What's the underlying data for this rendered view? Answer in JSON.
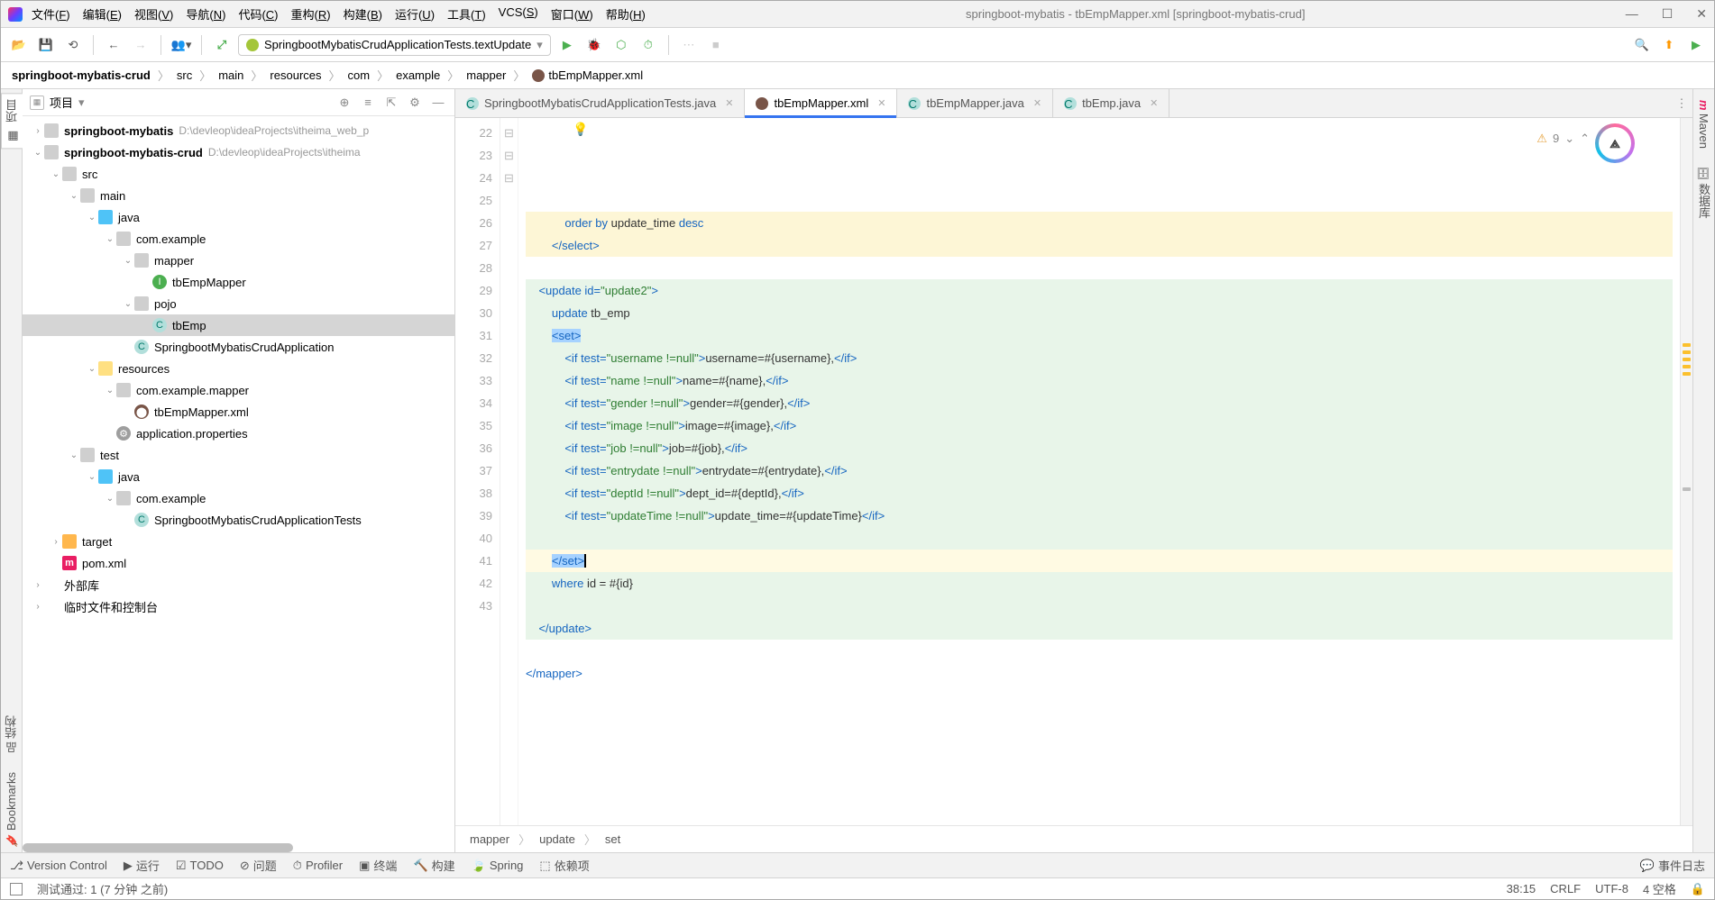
{
  "title": "springboot-mybatis - tbEmpMapper.xml [springboot-mybatis-crud]",
  "menus": [
    "文件(F)",
    "编辑(E)",
    "视图(V)",
    "导航(N)",
    "代码(C)",
    "重构(R)",
    "构建(B)",
    "运行(U)",
    "工具(T)",
    "VCS(S)",
    "窗口(W)",
    "帮助(H)"
  ],
  "run_config": "SpringbootMybatisCrudApplicationTests.textUpdate",
  "breadcrumbs": [
    "springboot-mybatis-crud",
    "src",
    "main",
    "resources",
    "com",
    "example",
    "mapper",
    "tbEmpMapper.xml"
  ],
  "project_label": "项目",
  "left_tabs": [
    "项目",
    "结构",
    "Bookmarks"
  ],
  "right_tabs": [
    "Maven",
    "数据库"
  ],
  "tree": [
    {
      "ind": 0,
      "arrow": "›",
      "icon": "folder-ico",
      "bold": true,
      "label": "springboot-mybatis",
      "path": "D:\\devleop\\ideaProjects\\itheima_web_p"
    },
    {
      "ind": 0,
      "arrow": "⌄",
      "icon": "folder-ico",
      "bold": true,
      "label": "springboot-mybatis-crud",
      "path": "D:\\devleop\\ideaProjects\\itheima"
    },
    {
      "ind": 1,
      "arrow": "⌄",
      "icon": "folder-ico",
      "label": "src"
    },
    {
      "ind": 2,
      "arrow": "⌄",
      "icon": "folder-ico",
      "label": "main"
    },
    {
      "ind": 3,
      "arrow": "⌄",
      "icon": "folder-blue",
      "label": "java"
    },
    {
      "ind": 4,
      "arrow": "⌄",
      "icon": "folder-ico",
      "label": "com.example"
    },
    {
      "ind": 5,
      "arrow": "⌄",
      "icon": "folder-ico",
      "label": "mapper"
    },
    {
      "ind": 6,
      "arrow": "",
      "icon": "file-int",
      "label": "tbEmpMapper"
    },
    {
      "ind": 5,
      "arrow": "⌄",
      "icon": "folder-ico",
      "label": "pojo"
    },
    {
      "ind": 6,
      "arrow": "",
      "icon": "file-java",
      "label": "tbEmp",
      "selected": true
    },
    {
      "ind": 5,
      "arrow": "",
      "icon": "file-java",
      "label": "SpringbootMybatisCrudApplication"
    },
    {
      "ind": 3,
      "arrow": "⌄",
      "icon": "folder-yellow",
      "label": "resources"
    },
    {
      "ind": 4,
      "arrow": "⌄",
      "icon": "folder-ico",
      "label": "com.example.mapper"
    },
    {
      "ind": 5,
      "arrow": "",
      "icon": "file-xml",
      "label": "tbEmpMapper.xml"
    },
    {
      "ind": 4,
      "arrow": "",
      "icon": "file-props",
      "label": "application.properties"
    },
    {
      "ind": 2,
      "arrow": "⌄",
      "icon": "folder-ico",
      "label": "test"
    },
    {
      "ind": 3,
      "arrow": "⌄",
      "icon": "folder-blue",
      "label": "java"
    },
    {
      "ind": 4,
      "arrow": "⌄",
      "icon": "folder-ico",
      "label": "com.example"
    },
    {
      "ind": 5,
      "arrow": "",
      "icon": "file-java",
      "label": "SpringbootMybatisCrudApplicationTests"
    },
    {
      "ind": 1,
      "arrow": "›",
      "icon": "folder-orange",
      "label": "target"
    },
    {
      "ind": 1,
      "arrow": "",
      "icon": "file-m",
      "label": "pom.xml"
    },
    {
      "ind": 0,
      "arrow": "›",
      "icon": "",
      "label": "外部库"
    },
    {
      "ind": 0,
      "arrow": "›",
      "icon": "",
      "label": "临时文件和控制台"
    }
  ],
  "editor_tabs": [
    {
      "label": "SpringbootMybatisCrudApplicationTests.java",
      "icon": "file-java"
    },
    {
      "label": "tbEmpMapper.xml",
      "icon": "file-xml",
      "active": true
    },
    {
      "label": "tbEmpMapper.java",
      "icon": "file-java"
    },
    {
      "label": "tbEmp.java",
      "icon": "file-java"
    }
  ],
  "line_start": 22,
  "line_end": 43,
  "code_breadcrumb": [
    "mapper",
    "update",
    "set"
  ],
  "bottom_tools": [
    "Version Control",
    "运行",
    "TODO",
    "问题",
    "Profiler",
    "终端",
    "构建",
    "Spring",
    "依赖项"
  ],
  "event_log": "事件日志",
  "status": {
    "test": "测试通过: 1 (7 分钟 之前)",
    "pos": "38:15",
    "eol": "CRLF",
    "enc": "UTF-8",
    "spaces": "4 空格",
    "lock": "🔒"
  }
}
